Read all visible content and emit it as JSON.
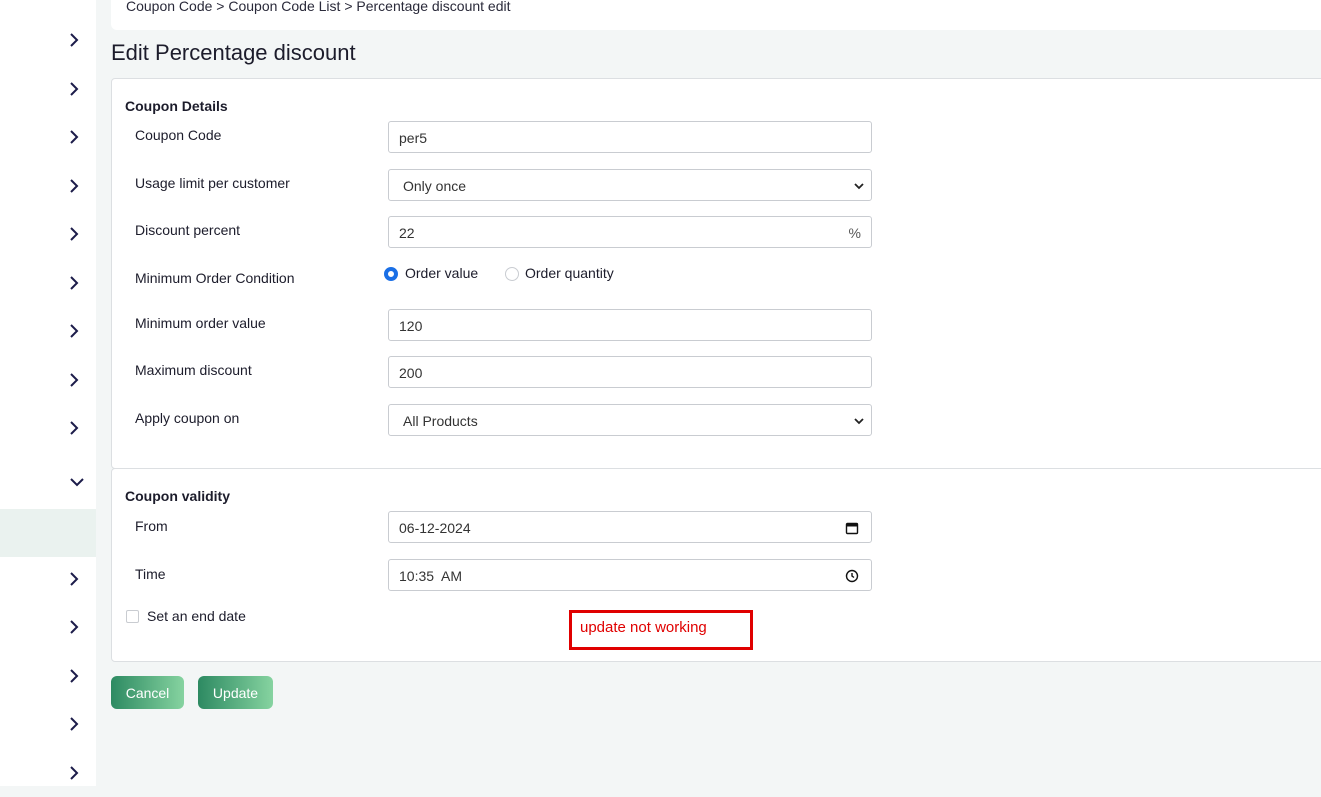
{
  "breadcrumb": {
    "text": "Coupon Code > Coupon Code List > Percentage discount edit"
  },
  "page": {
    "title": "Edit Percentage discount"
  },
  "coupon_details": {
    "section_title": "Coupon Details",
    "coupon_code": {
      "label": "Coupon Code",
      "value": "per5"
    },
    "usage_limit": {
      "label": "Usage limit per customer",
      "value": "Only once"
    },
    "discount_percent": {
      "label": "Discount percent",
      "value": "22",
      "suffix": "%"
    },
    "min_order_condition": {
      "label": "Minimum Order Condition",
      "options": [
        "Order value",
        "Order quantity"
      ],
      "selected": "Order value"
    },
    "min_order_value": {
      "label": "Minimum order value",
      "value": "120"
    },
    "max_discount": {
      "label": "Maximum discount",
      "value": "200"
    },
    "apply_coupon_on": {
      "label": "Apply coupon on",
      "value": "All Products"
    }
  },
  "coupon_validity": {
    "section_title": "Coupon validity",
    "from": {
      "label": "From",
      "value": "06-12-2024"
    },
    "time": {
      "label": "Time",
      "value": "10:35  AM"
    },
    "end_date": {
      "label": "Set an end date",
      "checked": false
    }
  },
  "annotation": {
    "text": "update not working",
    "color": "#e00000"
  },
  "actions": {
    "cancel_label": "Cancel",
    "update_label": "Update"
  },
  "theme": {
    "accent": "#2d8a62",
    "radio_accent": "#1a6fe6",
    "sidebar_chevron": "#1c1c4a"
  },
  "sidebar": {
    "items": [
      {
        "icon": "chevron-right-icon"
      },
      {
        "icon": "chevron-right-icon"
      },
      {
        "icon": "chevron-right-icon"
      },
      {
        "icon": "chevron-right-icon"
      },
      {
        "icon": "chevron-right-icon"
      },
      {
        "icon": "chevron-right-icon"
      },
      {
        "icon": "chevron-right-icon"
      },
      {
        "icon": "chevron-right-icon"
      },
      {
        "icon": "chevron-right-icon"
      },
      {
        "icon": "chevron-down-icon"
      },
      {
        "icon": "none"
      },
      {
        "icon": "chevron-right-icon"
      },
      {
        "icon": "chevron-right-icon"
      },
      {
        "icon": "chevron-right-icon"
      },
      {
        "icon": "chevron-right-icon"
      },
      {
        "icon": "chevron-right-icon"
      }
    ]
  }
}
